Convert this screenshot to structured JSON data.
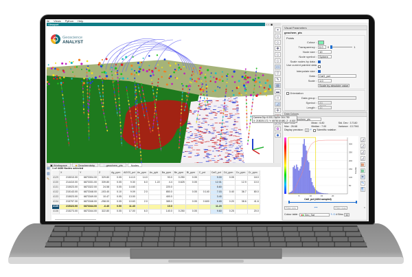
{
  "menu": [
    "ile",
    "Views",
    "Python",
    "Help"
  ],
  "viewport": {
    "title": "Viewport",
    "logo_line1": "Geoscience",
    "logo_line2": "ANALYST",
    "tooltip_line1": "Camera Dip: 6.000, DipDir: 304.759",
    "tooltip_line2": "X: 215025.172, Y: 6875018.680, Z: -6.618"
  },
  "visual_parameters": {
    "title": "Visual Parameters",
    "object": "geochem_pts",
    "group": "Points",
    "colour_label": "Colour :",
    "colour": "#7ef2b4",
    "transparency_label": "Transparency :",
    "transparency": "0.0",
    "slider_min": "0",
    "slider_max": "1",
    "transparency_value": 0,
    "node_size_label": "Node size :",
    "node_size": "10",
    "node_symbol_label": "Node symbol :",
    "node_symbol": "Sphere",
    "scale_nodes_label": "Scale nodes by data :",
    "scale_nodes": true,
    "use_painted_label": "Use current painted data :",
    "use_painted": false,
    "interpolate_label": "Interpolate size :",
    "interpolate": true,
    "data_label": "Data :",
    "data": "CaO_pct",
    "scale_label": "Scale :",
    "scale": "1.0",
    "scale_abs_button": "Scale by absolute value",
    "orientation_label": "Orientation",
    "orientation": false,
    "data_group_label": "Data group :",
    "symbol_label": "Symbol :",
    "symbol": "2D arrow",
    "length_label": "Length :",
    "length": "10"
  },
  "data_colours": {
    "title": "Data Colours",
    "object_label": "Object :",
    "object": "geochem_pts",
    "min_label": "Min :",
    "min": "0.00",
    "max_label": "Max :",
    "max": "26.68",
    "mean_label": "Mean :",
    "mean": "6.80",
    "median_label": "Median :",
    "median": "7.00",
    "std_label": "Std. Dev :",
    "std": "3.7140",
    "var_label": "Variance :",
    "var": "13.7941",
    "precision_label": "Display precision :",
    "precision": "2",
    "sci_label": "Scientific notation",
    "filter_min": "Filter min",
    "filter_max": "Filter max",
    "colour_table_label": "Colour table :",
    "colour_table": "Geo_Sat",
    "bins_label": "# Bins :",
    "bins": "50"
  },
  "chart_data": {
    "type": "bar",
    "title": "",
    "xlabel": "CaO_pct (4404 sampled)",
    "ylabel": "Counts",
    "bin_start": 0,
    "bin_width": 0.5,
    "values": [
      5,
      8,
      12,
      18,
      160,
      170,
      150,
      175,
      160,
      140,
      150,
      165,
      220,
      300,
      330,
      290,
      260,
      200,
      190,
      140,
      95,
      70,
      50,
      38,
      28,
      20,
      14,
      10,
      7,
      5,
      4,
      3,
      2,
      2,
      1,
      1
    ],
    "xticks": [
      "5",
      "10",
      "15",
      "20"
    ],
    "yticks": [
      "300",
      "250",
      "200",
      "150",
      "100",
      "50"
    ],
    "xlim": [
      0,
      26.68
    ],
    "ylim": [
      0,
      340
    ],
    "filter_range": [
      0,
      12.3
    ],
    "grid": true
  },
  "tabs": [
    "Workspace",
    "Geochemistry",
    "geochem_pts",
    "Nodes"
  ],
  "table": {
    "status": "1 of 4436 Nodes selected",
    "columns": [
      "",
      "X",
      "Y",
      "Z",
      "Ag_ppm",
      "Al2O3_pct",
      "As_ppm",
      "Au_ppb",
      "Ba_ppm",
      "Be_ppm",
      "Bi_ppm",
      "C_pct",
      "CaO_pct",
      "Cd_ppm",
      "Co_ppm",
      "Cr_ppm"
    ],
    "rows": [
      [
        "4129",
        "215010.00",
        "6873304.00",
        "329.80",
        "0.05",
        "14.10",
        "14.0",
        "",
        "93.0",
        "0.250",
        "0.05",
        "",
        "9.00",
        "0.05",
        "",
        "18.0"
      ],
      [
        "4130",
        "214410.00",
        "6873331.00",
        "339.80",
        "0.05",
        "9.30",
        "6.0",
        "1.22",
        "4.4",
        "0.625",
        "0.05",
        "",
        "12.01",
        "",
        "12.9",
        "10.0"
      ],
      [
        "4131",
        "215023.00",
        "6873322.00",
        "24.58",
        "0.05",
        "14.60",
        "",
        "",
        "220.0",
        "",
        "",
        "",
        "5.60",
        "",
        "",
        ""
      ],
      [
        "4132",
        "215143.00",
        "6873348.00",
        "-103.40",
        "0.10",
        "9.09",
        "2.0",
        "",
        "850.0",
        "",
        "0.05",
        "0.140",
        "7.03",
        "0.40",
        "36.7",
        "80.0"
      ],
      [
        "4133",
        "215023.00",
        "6873349.00",
        "10.47",
        "0.05",
        "13.00",
        "",
        "",
        "400.0",
        "",
        "",
        "",
        "3.40",
        "",
        "",
        ""
      ],
      [
        "4134",
        "215797.30",
        "6873346.00",
        "-258.00",
        "0.05",
        "10.63",
        "2.0",
        "",
        "385.0",
        "",
        "0.05",
        "0.600",
        "6.65",
        "0.20",
        "38.6",
        "41.6"
      ],
      [
        "4135",
        "215323.90",
        "6873344.00",
        "-6.40",
        "0.50",
        "11.40",
        "",
        "",
        "10.0",
        "",
        "",
        "",
        "11.20",
        "",
        "",
        ""
      ],
      [
        "4136",
        "215273.00",
        "6873344.00",
        "322.80",
        "0.05",
        "17.00",
        "6.0",
        "",
        "140.0",
        "0.250",
        "0.05",
        "",
        "9.60",
        "0.25",
        "",
        "20.0"
      ]
    ],
    "selected_row": "4135"
  }
}
